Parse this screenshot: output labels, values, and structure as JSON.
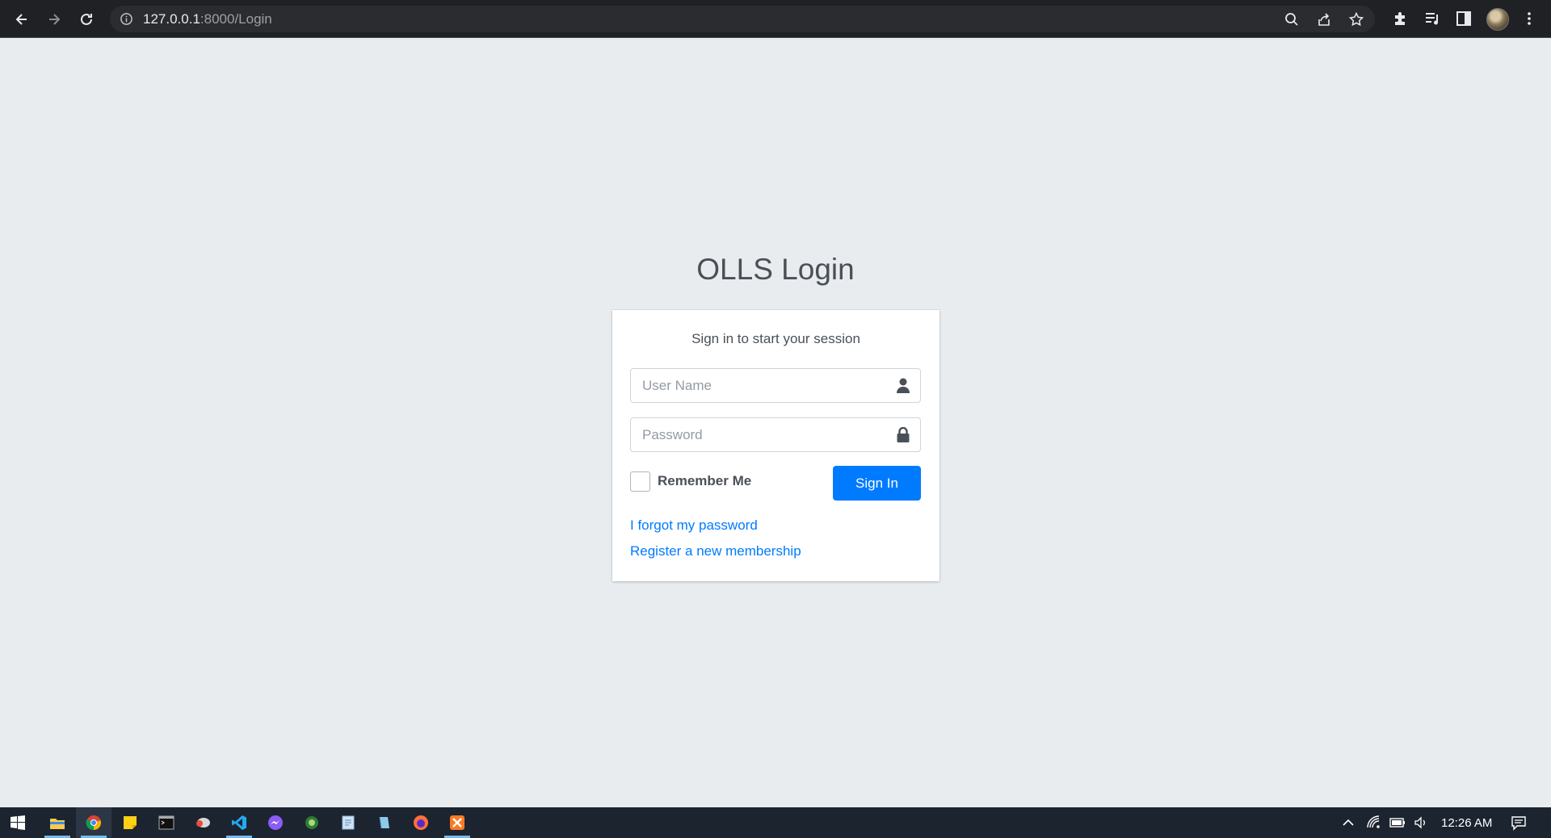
{
  "browser": {
    "url_host": "127.0.0.1",
    "url_path": ":8000/Login"
  },
  "login": {
    "logo_bold": "OLLS",
    "logo_light": " Login",
    "message": "Sign in to start your session",
    "username_placeholder": "User Name",
    "password_placeholder": "Password",
    "remember_label": "Remember Me",
    "signin_label": "Sign In",
    "forgot_link": "I forgot my password",
    "register_link": "Register a new membership"
  },
  "taskbar": {
    "clock": "12:26 AM"
  },
  "colors": {
    "primary": "#007bff",
    "background": "#e9ecef",
    "taskbar": "#1c2430",
    "chrome": "#202124"
  }
}
